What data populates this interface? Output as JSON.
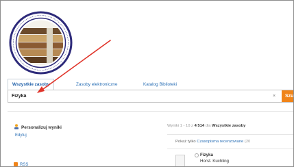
{
  "tabs": [
    {
      "label": "Wszystkie zasoby",
      "active": true
    },
    {
      "label": "Zasoby elektroniczne",
      "active": false
    },
    {
      "label": "Katalog Biblioteki",
      "active": false
    }
  ],
  "search": {
    "value": "Fizyka",
    "clear_symbol": "×",
    "button_label": "Szu"
  },
  "sidebar": {
    "personalize_label": "Personalizuj wyniki",
    "edit_label": "Edytuj",
    "rss_label": "RSS"
  },
  "results": {
    "prefix": "Wyniki 1 - 10 z",
    "total": "4 514",
    "middle": "dla",
    "scope": "Wszystkie zasoby",
    "filter_prefix": "Pokaż tylko",
    "filter_link": "Czasopisma recenzowane",
    "filter_count": "(20",
    "first_title": "Fizyka",
    "first_author": "Horst. Kuchling"
  },
  "colors": {
    "accent": "#f08419",
    "link": "#2a6fb5",
    "annotation_arrow": "#e0342a"
  }
}
